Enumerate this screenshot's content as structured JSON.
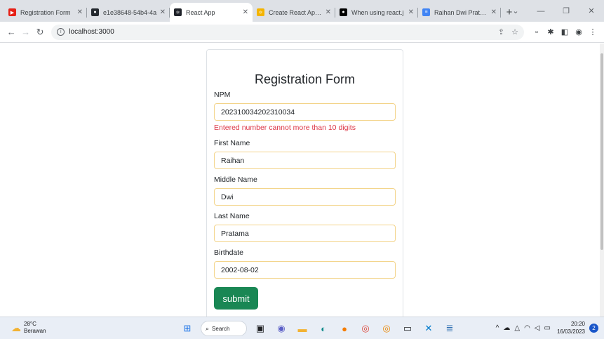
{
  "browser": {
    "tabs": [
      {
        "title": "Registration Form",
        "favicon": "youtube-icon",
        "color": "#e62117",
        "glyph": "▶"
      },
      {
        "title": "e1e38648-54b4-4a",
        "favicon": "github-icon",
        "color": "#24292f",
        "glyph": "●"
      },
      {
        "title": "React App",
        "favicon": "react-icon",
        "color": "#20232a",
        "glyph": "⚛"
      },
      {
        "title": "Create React App w",
        "favicon": "create-react-app-icon",
        "color": "#f4b400",
        "glyph": "⚛"
      },
      {
        "title": "When using react.j",
        "favicon": "medium-icon",
        "color": "#000000",
        "glyph": "●"
      },
      {
        "title": "Raihan Dwi Pratam",
        "favicon": "google-docs-icon",
        "color": "#4285f4",
        "glyph": "≡"
      }
    ],
    "active_tab_index": 2,
    "new_tab_glyph": "+",
    "url": "localhost:3000"
  },
  "form": {
    "title": "Registration Form",
    "fields": [
      {
        "label": "NPM",
        "value": "202310034202310034",
        "error": "Entered number cannot more than 10 digits"
      },
      {
        "label": "First Name",
        "value": "Raihan"
      },
      {
        "label": "Middle Name",
        "value": "Dwi"
      },
      {
        "label": "Last Name",
        "value": "Pratama"
      },
      {
        "label": "Birthdate",
        "value": "2002-08-02"
      }
    ],
    "submit_label": "submit"
  },
  "taskbar": {
    "weather_temp": "28°C",
    "weather_desc": "Berawan",
    "search_label": "Search",
    "time": "20:20",
    "date": "16/03/2023",
    "notification_count": "2"
  },
  "colors": {
    "submit_button": "#198754",
    "error_text": "#dc3545",
    "input_border": "#f3d48a"
  }
}
